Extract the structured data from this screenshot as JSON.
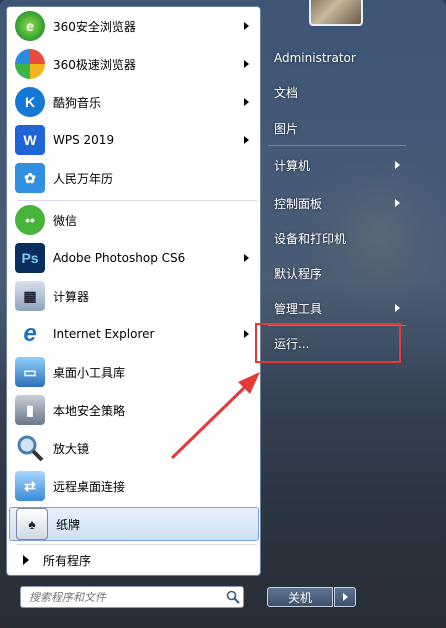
{
  "programs": [
    {
      "label": "360安全浏览器",
      "icon": "360-safe-browser-icon",
      "has_submenu": true,
      "color": "#3aa63a"
    },
    {
      "label": "360极速浏览器",
      "icon": "360-speed-browser-icon",
      "has_submenu": true,
      "color": "#e8a21b"
    },
    {
      "label": "酷狗音乐",
      "icon": "kugou-music-icon",
      "has_submenu": true,
      "color": "#1479d6"
    },
    {
      "label": "WPS 2019",
      "icon": "wps-icon",
      "has_submenu": true,
      "color": "#1f65d6"
    },
    {
      "label": "人民万年历",
      "icon": "calendar-app-icon",
      "has_submenu": false,
      "color": "#2f8fe0"
    },
    {
      "label": "微信",
      "icon": "wechat-icon",
      "has_submenu": false,
      "color": "#48b33a"
    },
    {
      "label": "Adobe Photoshop CS6",
      "icon": "photoshop-icon",
      "has_submenu": true,
      "color": "#0c2e5c"
    },
    {
      "label": "计算器",
      "icon": "calculator-icon",
      "has_submenu": false,
      "color": "#6d7f95"
    },
    {
      "label": "Internet Explorer",
      "icon": "internet-explorer-icon",
      "has_submenu": true,
      "color": "#1a73c9"
    },
    {
      "label": "桌面小工具库",
      "icon": "desktop-gadgets-icon",
      "has_submenu": false,
      "color": "#3c7fc7"
    },
    {
      "label": "本地安全策略",
      "icon": "security-policy-icon",
      "has_submenu": false,
      "color": "#6b7788"
    },
    {
      "label": "放大镜",
      "icon": "magnifier-icon",
      "has_submenu": false,
      "color": "#4a7db5"
    },
    {
      "label": "远程桌面连接",
      "icon": "remote-desktop-icon",
      "has_submenu": false,
      "color": "#3b8bd6"
    },
    {
      "label": "纸牌",
      "icon": "solitaire-icon",
      "has_submenu": false,
      "color": "#2e6fb8"
    }
  ],
  "all_programs_label": "所有程序",
  "search": {
    "placeholder": "搜索程序和文件"
  },
  "right_items": [
    {
      "label": "Administrator",
      "has_submenu": false
    },
    {
      "label": "文档",
      "has_submenu": false
    },
    {
      "label": "图片",
      "has_submenu": false
    },
    {
      "label": "计算机",
      "has_submenu": true
    },
    {
      "label": "控制面板",
      "has_submenu": true
    },
    {
      "label": "设备和打印机",
      "has_submenu": false
    },
    {
      "label": "默认程序",
      "has_submenu": false
    },
    {
      "label": "管理工具",
      "has_submenu": true
    },
    {
      "label": "运行...",
      "has_submenu": false
    }
  ],
  "shutdown_label": "关机",
  "colors": {
    "highlight": "#e53935",
    "selected_item": "#cfe0f5"
  }
}
